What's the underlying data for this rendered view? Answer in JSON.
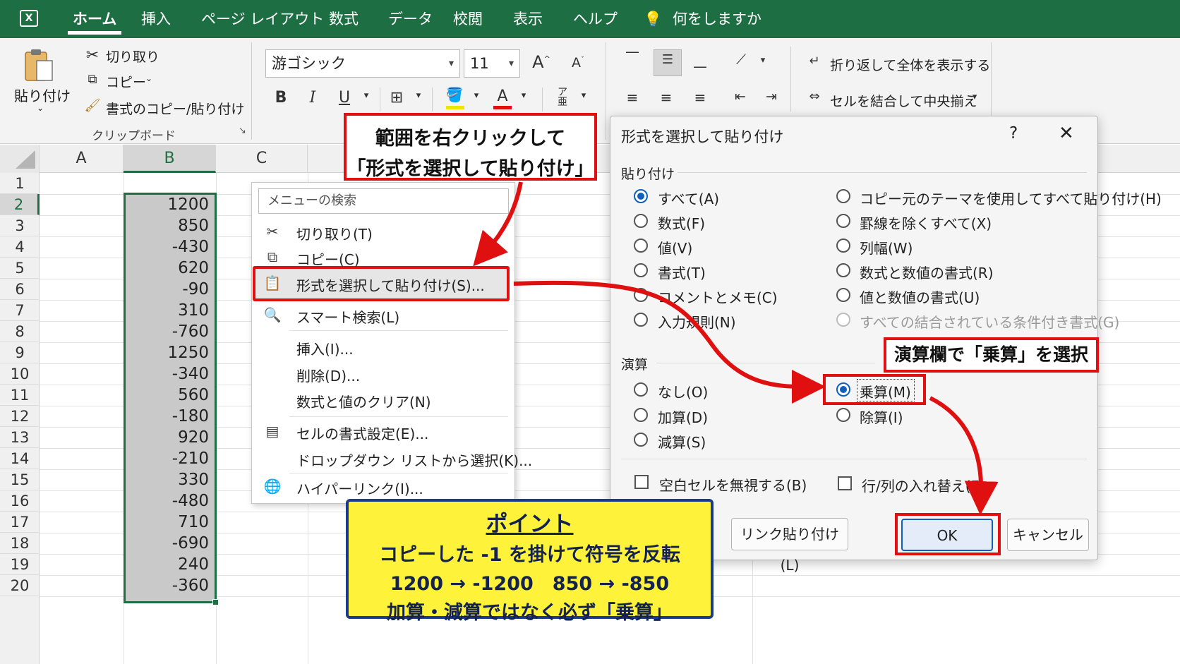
{
  "ribbon_tabs": [
    "ホーム",
    "挿入",
    "ページ レイアウト",
    "数式",
    "データ",
    "校閲",
    "表示",
    "ヘルプ"
  ],
  "tell_me": "何をしますか",
  "clipboard": {
    "paste_label": "貼り付け",
    "cut_label": "切り取り",
    "copy_label": "コピー",
    "format_painter_label": "書式のコピー/貼り付け",
    "group_label": "クリップボード"
  },
  "font": {
    "name": "游ゴシック",
    "size": "11"
  },
  "alignment": {
    "wrap_label": "折り返して全体を表示する",
    "merge_label": "セルを結合して中央揃え"
  },
  "sheet": {
    "columns": [
      "A",
      "B",
      "C"
    ],
    "rows": [
      "1",
      "2",
      "3",
      "4",
      "5",
      "6",
      "7",
      "8",
      "9",
      "10",
      "11",
      "12",
      "13",
      "14",
      "15",
      "16",
      "17",
      "18",
      "19",
      "20"
    ],
    "b_values": [
      "1200",
      "850",
      "-430",
      "620",
      "-90",
      "310",
      "-760",
      "1250",
      "-340",
      "560",
      "-180",
      "920",
      "-210",
      "330",
      "-480",
      "710",
      "-690",
      "240",
      "-360"
    ]
  },
  "context_menu": {
    "search_placeholder": "メニューの検索",
    "items": [
      "切り取り(T)",
      "コピー(C)",
      "形式を選択して貼り付け(S)...",
      "スマート検索(L)",
      "挿入(I)...",
      "削除(D)...",
      "数式と値のクリア(N)",
      "セルの書式設定(E)...",
      "ドロップダウン リストから選択(K)...",
      "ハイパーリンク(I)..."
    ]
  },
  "dialog": {
    "title": "形式を選択して貼り付け",
    "help": "?",
    "close": "✕",
    "paste_section": "貼り付け",
    "paste_left": [
      "すべて(A)",
      "数式(F)",
      "値(V)",
      "書式(T)",
      "コメントとメモ(C)",
      "入力規則(N)"
    ],
    "paste_right": [
      "コピー元のテーマを使用してすべて貼り付け(H)",
      "罫線を除くすべて(X)",
      "列幅(W)",
      "数式と数値の書式(R)",
      "値と数値の書式(U)",
      "すべての結合されている条件付き書式(G)"
    ],
    "operation_section": "演算",
    "op_left": [
      "なし(O)",
      "加算(D)",
      "減算(S)"
    ],
    "op_right": [
      "乗算(M)",
      "除算(I)"
    ],
    "skip_blanks": "空白セルを無視する(B)",
    "transpose": "行/列の入れ替え(E)",
    "paste_link": "リンク貼り付け(L)",
    "ok": "OK",
    "cancel": "キャンセル"
  },
  "annotations": {
    "step1_line1": "範囲を右クリックして",
    "step1_line2": "「形式を選択して貼り付け」",
    "step2": "演算欄で「乗算」を選択",
    "point_title": "ポイント",
    "point_line1": "コピーした -1 を掛けて符号を反転",
    "point_line2": "1200 → -1200　850 → -850",
    "point_line3": "加算・減算ではなく必ず「乗算」"
  }
}
